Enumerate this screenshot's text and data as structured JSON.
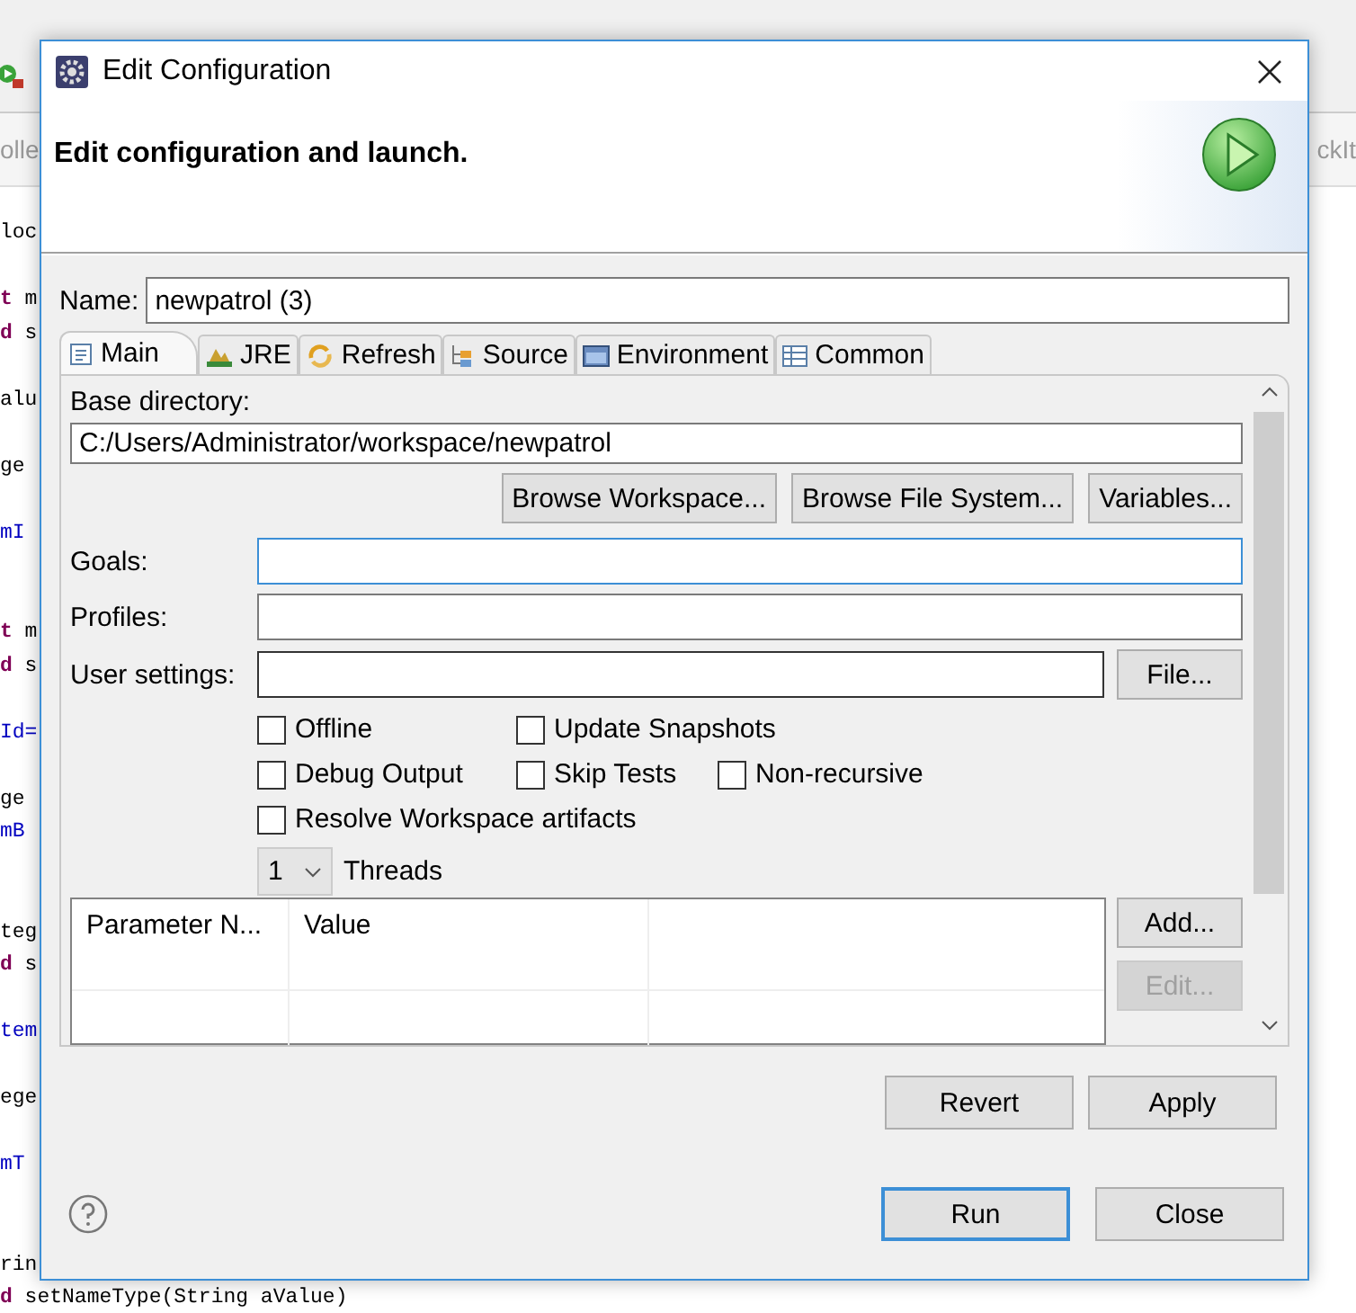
{
  "editor": {
    "tab_left": "olle",
    "tab_right": "ckIt",
    "lines": [
      {
        "text": "loc",
        "kind": "plain"
      },
      {
        "text": "**t** m",
        "kind": "plain"
      },
      {
        "text": "**d** s",
        "kind": "plain"
      },
      {
        "text": "alu",
        "kind": "plain"
      },
      {
        "text": "ge",
        "kind": "plain"
      },
      {
        "text": "mI",
        "kind": "field"
      },
      {
        "text": "**t** m",
        "kind": "plain"
      },
      {
        "text": "**d** s",
        "kind": "plain"
      },
      {
        "text": "Id=",
        "kind": "field"
      },
      {
        "text": "ge",
        "kind": "plain"
      },
      {
        "text": "mB",
        "kind": "field"
      },
      {
        "text": "teg",
        "kind": "plain"
      },
      {
        "text": "**d** s",
        "kind": "plain"
      },
      {
        "text": "tem",
        "kind": "field"
      },
      {
        "text": "ege",
        "kind": "plain"
      },
      {
        "text": "mT",
        "kind": "field"
      },
      {
        "text": "rin",
        "kind": "plain"
      },
      {
        "text": "**d** setNameType(String aValue)",
        "kind": "plain"
      }
    ]
  },
  "dialog": {
    "title": "Edit Configuration",
    "heading": "Edit configuration and launch.",
    "name": {
      "label": "Name:",
      "value": "newpatrol (3)"
    },
    "tabs": [
      {
        "label": "Main",
        "kind": "main",
        "selected": true
      },
      {
        "label": "JRE",
        "kind": "jre",
        "selected": false
      },
      {
        "label": "Refresh",
        "kind": "refresh",
        "selected": false
      },
      {
        "label": "Source",
        "kind": "source",
        "selected": false
      },
      {
        "label": "Environment",
        "kind": "environment",
        "selected": false
      },
      {
        "label": "Common",
        "kind": "common",
        "selected": false
      }
    ],
    "main": {
      "base_directory": {
        "label": "Base directory:",
        "value": "C:/Users/Administrator/workspace/newpatrol"
      },
      "base_buttons": [
        "Browse Workspace...",
        "Browse File System...",
        "Variables..."
      ],
      "goals": {
        "label": "Goals:",
        "focused": true
      },
      "profiles": {
        "label": "Profiles:",
        "focused": false
      },
      "user_settings": {
        "label": "User settings:",
        "button": "File..."
      },
      "option_rows": [
        [
          {
            "label": "Offline",
            "checked": false
          },
          {
            "label": "Update Snapshots",
            "checked": false
          }
        ],
        [
          {
            "label": "Debug Output",
            "checked": false
          },
          {
            "label": "Skip Tests",
            "checked": false
          },
          {
            "label": "Non-recursive",
            "checked": false
          }
        ],
        [
          {
            "label": "Resolve Workspace artifacts",
            "checked": false
          }
        ]
      ],
      "threads": {
        "value": "1",
        "label": "Threads"
      },
      "parameters": {
        "columns": [
          "Parameter N...",
          "Value"
        ],
        "buttons": [
          {
            "label": "Add...",
            "disabled": false
          },
          {
            "label": "Edit...",
            "disabled": true
          }
        ]
      }
    },
    "actions": [
      "Revert",
      "Apply"
    ],
    "footer_buttons": [
      {
        "label": "Run",
        "default": true
      },
      {
        "label": "Close",
        "default": false
      }
    ]
  }
}
